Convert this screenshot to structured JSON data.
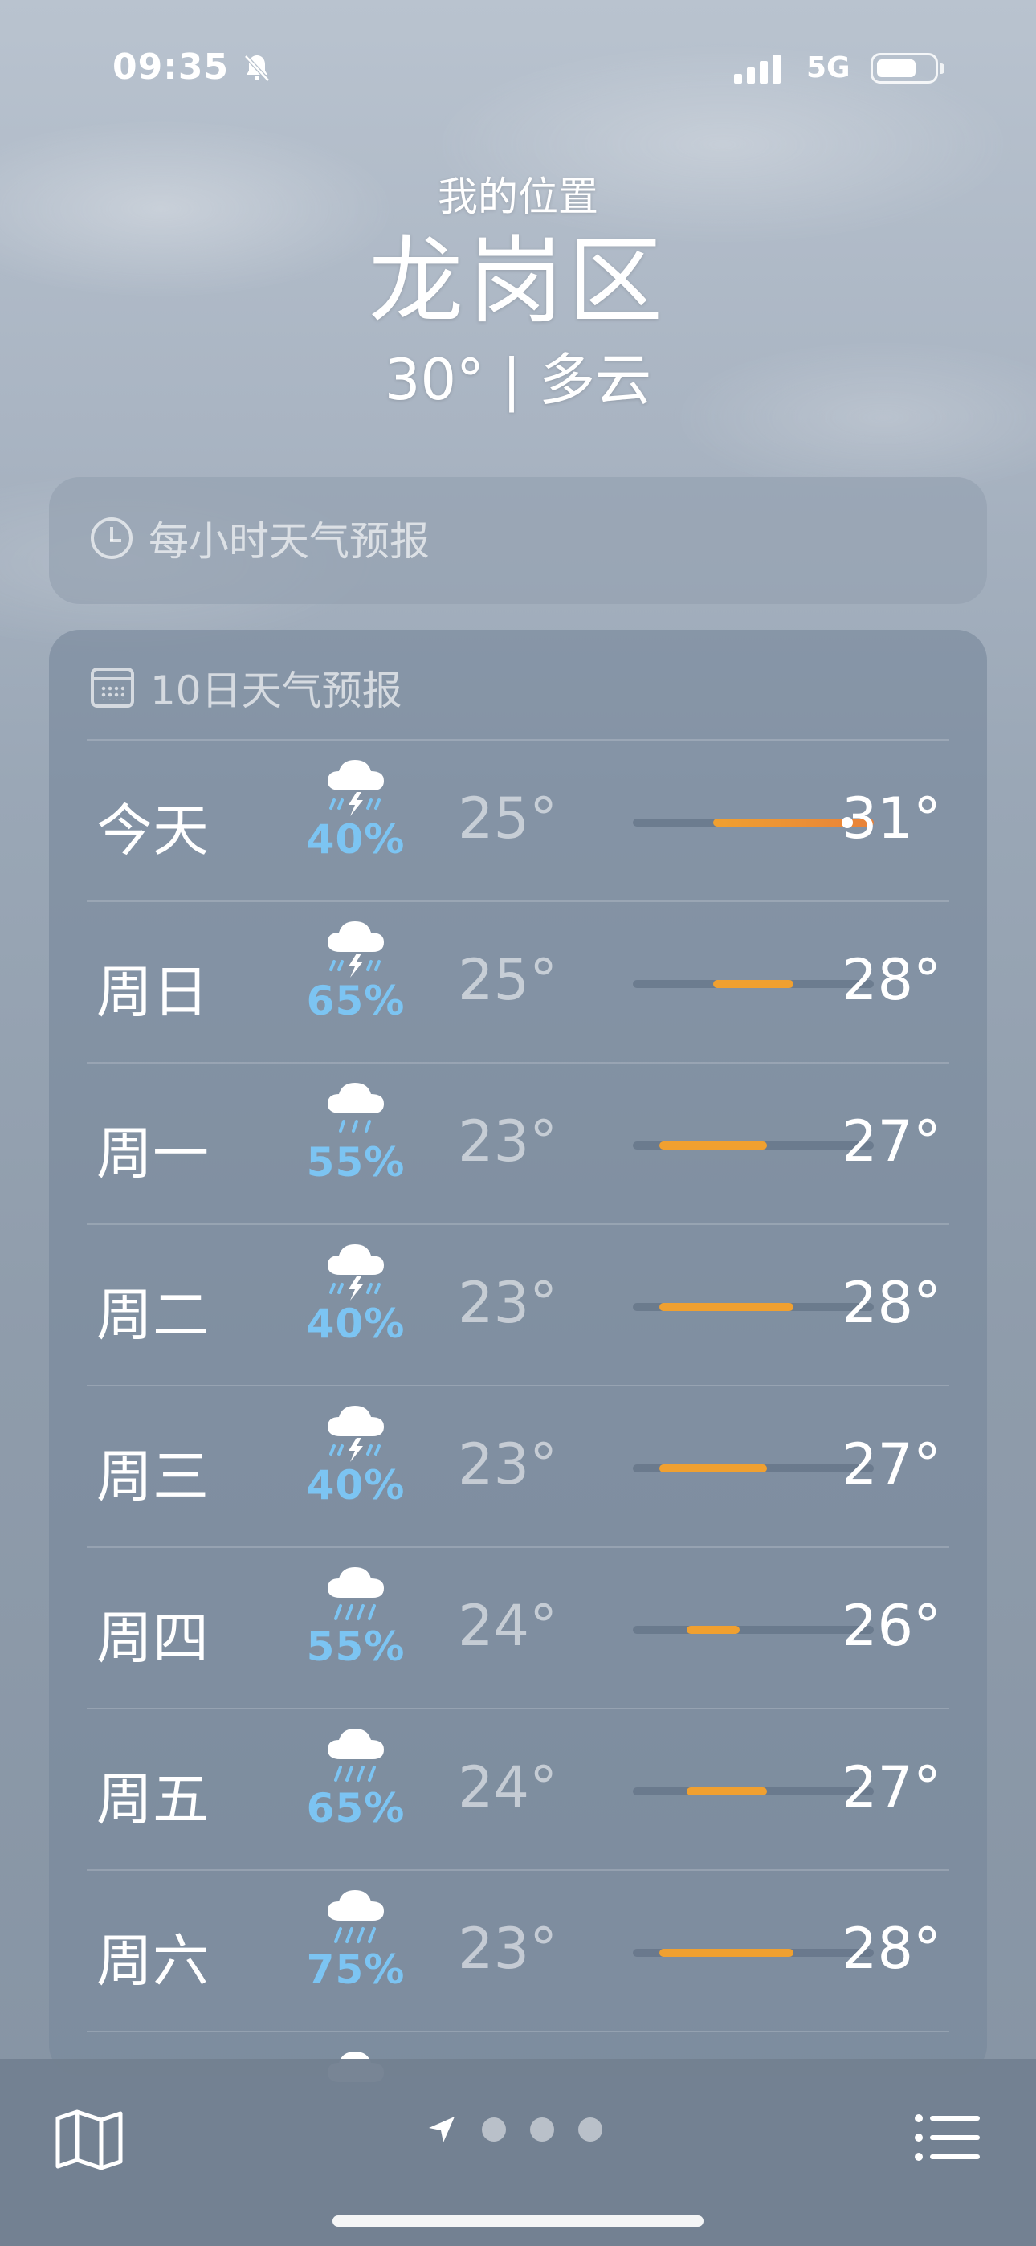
{
  "status": {
    "time": "09:35",
    "network": "5G",
    "battery_level": 0.65
  },
  "header": {
    "location_label": "我的位置",
    "city": "龙岗区",
    "summary": "30° | 多云"
  },
  "hourly": {
    "title": "每小时天气预报",
    "icon": "clock-icon"
  },
  "tenday": {
    "title": "10日天气预报",
    "icon": "calendar-icon",
    "days": [
      {
        "day": "今天",
        "icon": "thunderstorm-icon",
        "precip": "40%",
        "low": "25°",
        "high": "31°",
        "range_low": 25,
        "range_high": 31,
        "current": 30
      },
      {
        "day": "周日",
        "icon": "thunderstorm-icon",
        "precip": "65%",
        "low": "25°",
        "high": "28°",
        "range_low": 25,
        "range_high": 28
      },
      {
        "day": "周一",
        "icon": "rain-icon",
        "precip": "55%",
        "low": "23°",
        "high": "27°",
        "range_low": 23,
        "range_high": 27
      },
      {
        "day": "周二",
        "icon": "thunderstorm-icon",
        "precip": "40%",
        "low": "23°",
        "high": "28°",
        "range_low": 23,
        "range_high": 28
      },
      {
        "day": "周三",
        "icon": "thunderstorm-icon",
        "precip": "40%",
        "low": "23°",
        "high": "27°",
        "range_low": 23,
        "range_high": 27
      },
      {
        "day": "周四",
        "icon": "heavy-rain-icon",
        "precip": "55%",
        "low": "24°",
        "high": "26°",
        "range_low": 24,
        "range_high": 26
      },
      {
        "day": "周五",
        "icon": "heavy-rain-icon",
        "precip": "65%",
        "low": "24°",
        "high": "27°",
        "range_low": 24,
        "range_high": 27
      },
      {
        "day": "周六",
        "icon": "heavy-rain-icon",
        "precip": "75%",
        "low": "23°",
        "high": "28°",
        "range_low": 23,
        "range_high": 28
      }
    ]
  },
  "temp_scale": {
    "min": 22,
    "max": 31
  },
  "colors": {
    "bar_orange": "#f0a030",
    "bar_hot": "#e8823a",
    "precip_blue": "#7cc4f2"
  },
  "bottom_bar": {
    "map_icon": "map-icon",
    "location_icon": "location-arrow-icon",
    "page_count": 3,
    "list_icon": "list-icon"
  }
}
